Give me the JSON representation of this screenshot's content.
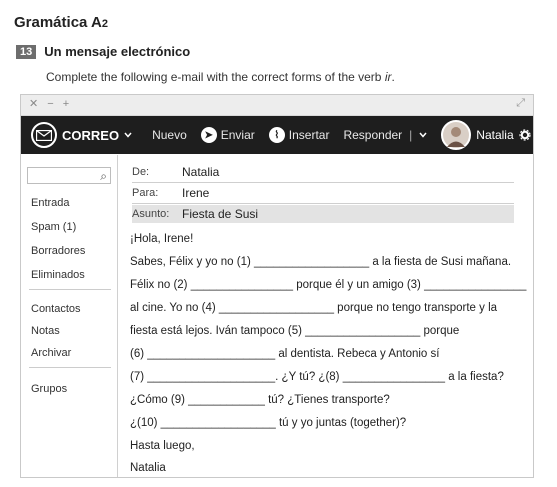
{
  "heading": {
    "main": "Gramática A",
    "sub": "2"
  },
  "exercise": {
    "number": "13",
    "title": "Un mensaje electrónico"
  },
  "instructions": {
    "text_before": "Complete the following e-mail with the correct forms of the verb ",
    "verb": "ir",
    "text_after": "."
  },
  "window": {
    "controls": "✕ − +",
    "expand_glyph": "⤢"
  },
  "toolbar": {
    "app_name": "CORREO",
    "nuevo": "Nuevo",
    "enviar": "Enviar",
    "insertar": "Insertar",
    "responder": "Responder",
    "user_name": "Natalia"
  },
  "sidebar": {
    "items": [
      "Entrada",
      "Spam (1)",
      "Borradores",
      "Eliminados",
      "Contactos",
      "Notas",
      "Archivar",
      "Grupos"
    ]
  },
  "email": {
    "from_label": "De:",
    "from_value": "Natalia",
    "to_label": "Para:",
    "to_value": "Irene",
    "subject_label": "Asunto:",
    "subject_value": "Fiesta de Susi",
    "lines": [
      "¡Hola, Irene!",
      "Sabes, Félix y yo no (1) __________________ a la fiesta de Susi mañana.",
      "Félix no (2) ________________ porque él y un amigo (3) ________________",
      "al cine. Yo no (4) __________________ porque no tengo transporte y la",
      "fiesta está lejos. Iván tampoco (5) __________________ porque",
      "(6) ____________________ al dentista. Rebeca y Antonio sí",
      "(7) ____________________. ¿Y tú? ¿(8) ________________ a la fiesta?",
      "¿Cómo (9) ____________ tú? ¿Tienes transporte?",
      "¿(10) __________________ tú y yo juntas (together)?",
      "Hasta luego,",
      "Natalia"
    ]
  }
}
